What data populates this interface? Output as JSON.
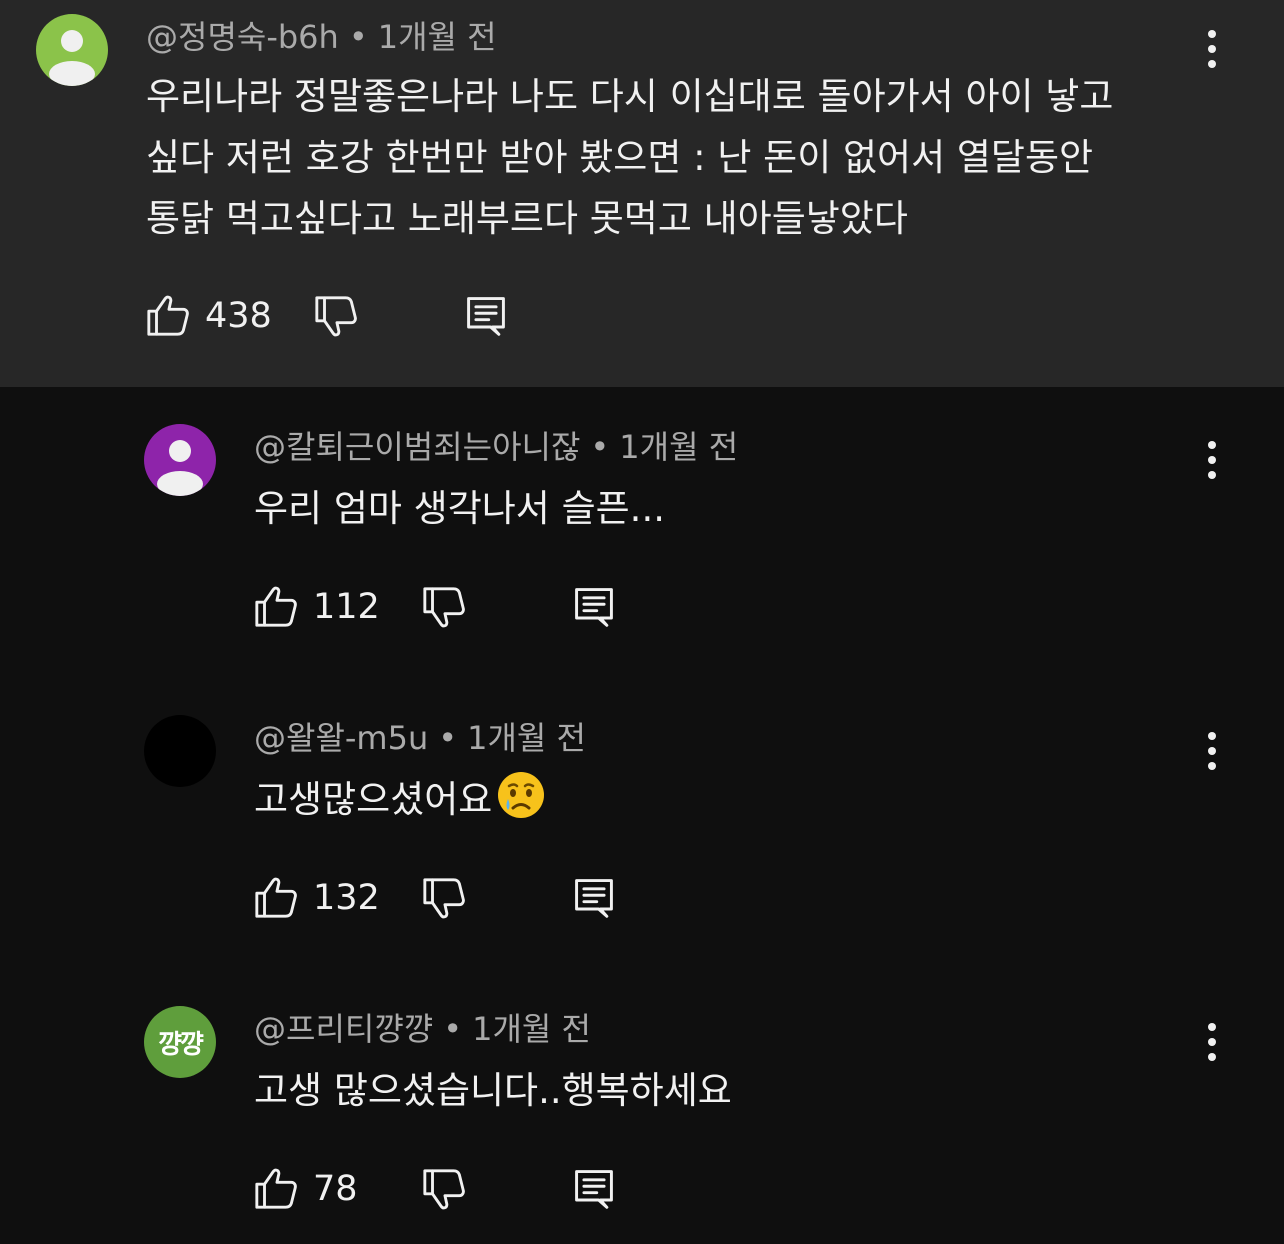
{
  "comments": [
    {
      "author": "@정명숙-b6h",
      "time": "1개월 전",
      "lines": [
        "우리나라 정말좋은나라  나도 다시 이십대로 돌아가서 아이 낳고",
        "싶다  저런 호강 한번만 받아 봤으면  :   난 돈이 없어서 열달동안",
        "통닭 먹고싶다고 노래부르다 못먹고 내아들낳았다"
      ],
      "likes": "438",
      "avatar_color": "#8bc34a"
    },
    {
      "author": "@칼퇴근이범죄는아니잖",
      "time": "1개월 전",
      "lines": [
        "우리 엄마 생각나서 슬픈..."
      ],
      "likes": "112",
      "avatar_color": "#8e24aa"
    },
    {
      "author": "@왈왈-m5u",
      "time": "1개월 전",
      "lines": [
        "고생많으셨어요"
      ],
      "emoji": "crying-face",
      "likes": "132",
      "avatar_color": "#000000"
    },
    {
      "author": "@프리티꺙꺙",
      "time": "1개월 전",
      "lines": [
        "고생 많으셨습니다..행복하세요"
      ],
      "likes": "78",
      "avatar_text": "꺙꺙",
      "avatar_color": "#5f9e3c"
    }
  ],
  "separator": "•"
}
